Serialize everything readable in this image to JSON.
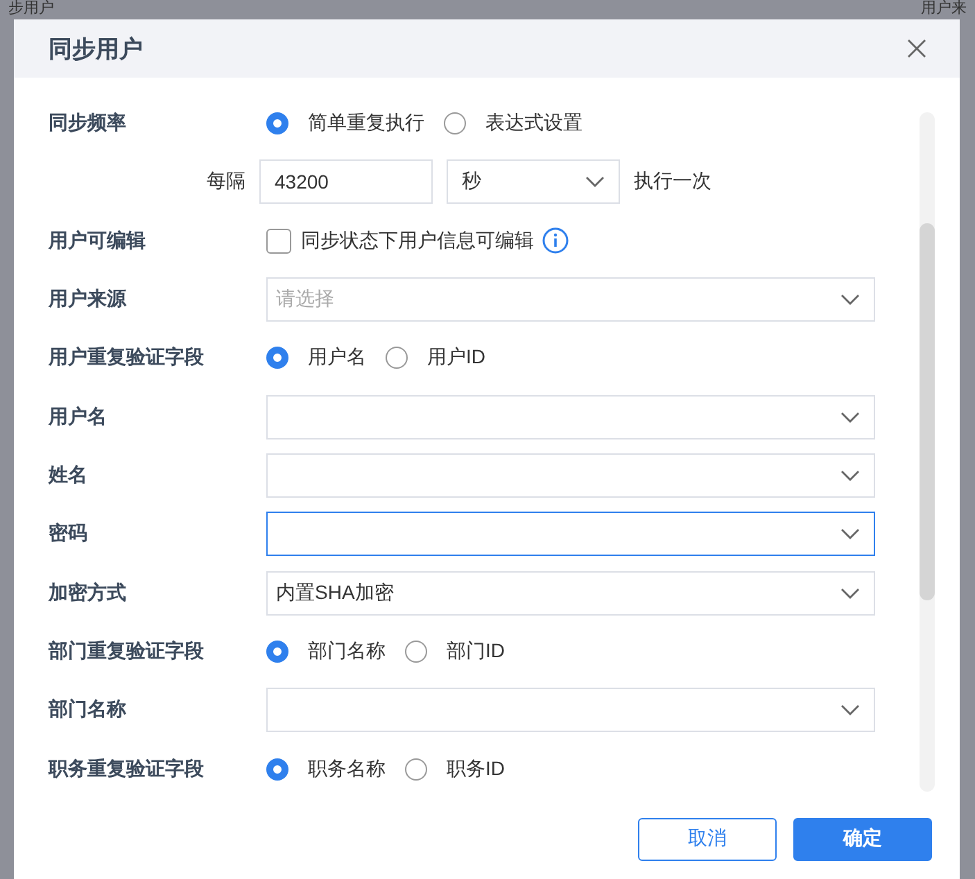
{
  "backdrop": {
    "text_left": "步用户",
    "text_right": "用户来"
  },
  "dialog": {
    "title": "同步用户",
    "fields": [
      {
        "kind": "radio",
        "label": "同步频率",
        "options": [
          {
            "label": "简单重复执行",
            "selected": true
          },
          {
            "label": "表达式设置",
            "selected": false
          }
        ]
      },
      {
        "kind": "interval",
        "prefix": "每隔",
        "value": "43200",
        "unit": "秒",
        "suffix": "执行一次"
      },
      {
        "kind": "checkbox",
        "label": "用户可编辑",
        "text": "同步状态下用户信息可编辑",
        "checked": false
      },
      {
        "kind": "select",
        "label": "用户来源",
        "placeholder": "请选择",
        "focused": false
      },
      {
        "kind": "radio",
        "label": "用户重复验证字段",
        "options": [
          {
            "label": "用户名",
            "selected": true
          },
          {
            "label": "用户ID",
            "selected": false
          }
        ]
      },
      {
        "kind": "select",
        "label": "用户名",
        "focused": false
      },
      {
        "kind": "select",
        "label": "姓名",
        "focused": false
      },
      {
        "kind": "select",
        "label": "密码",
        "focused": true
      },
      {
        "kind": "select",
        "label": "加密方式",
        "value": "内置SHA加密",
        "focused": false
      },
      {
        "kind": "radio",
        "label": "部门重复验证字段",
        "options": [
          {
            "label": "部门名称",
            "selected": true
          },
          {
            "label": "部门ID",
            "selected": false
          }
        ]
      },
      {
        "kind": "select",
        "label": "部门名称",
        "focused": false
      },
      {
        "kind": "radio",
        "label": "职务重复验证字段",
        "options": [
          {
            "label": "职务名称",
            "selected": true
          },
          {
            "label": "职务ID",
            "selected": false
          }
        ]
      }
    ],
    "buttons": [
      {
        "label": "取消",
        "primary": false
      },
      {
        "label": "确定",
        "primary": true
      }
    ]
  }
}
